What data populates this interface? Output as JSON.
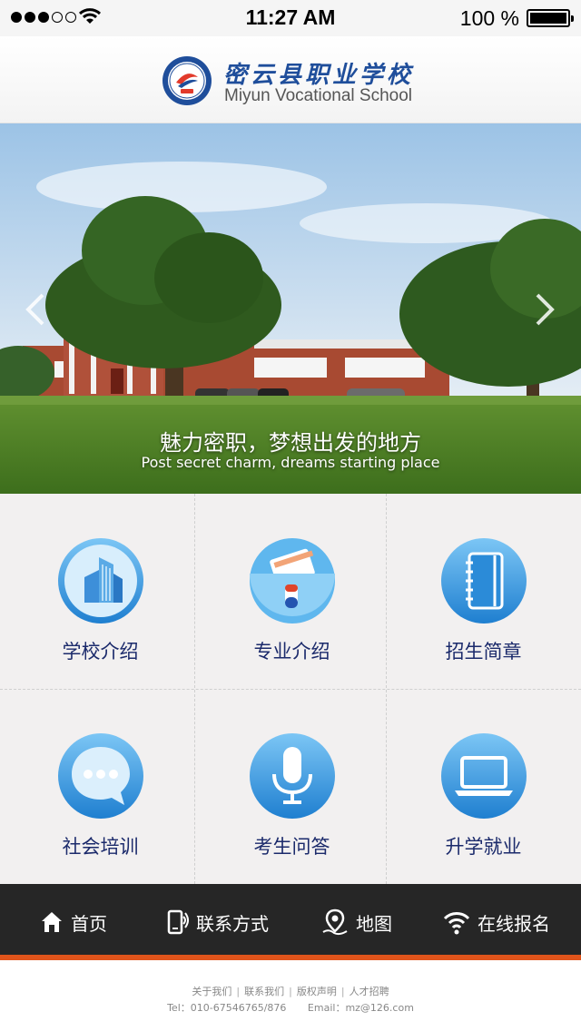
{
  "status_bar": {
    "time": "11:27 AM",
    "battery": "100 %"
  },
  "header": {
    "school_name_cn": "密云县职业学校",
    "school_name_en": "Miyun Vocational School"
  },
  "banner": {
    "caption_cn": "魅力密职，梦想出发的地方",
    "caption_en": "Post secret charm, dreams starting place"
  },
  "grid": {
    "items": [
      {
        "label": "学校介绍",
        "icon": "building-icon"
      },
      {
        "label": "专业介绍",
        "icon": "folder-icon"
      },
      {
        "label": "招生简章",
        "icon": "notebook-icon"
      },
      {
        "label": "社会培训",
        "icon": "chat-bubble-icon"
      },
      {
        "label": "考生问答",
        "icon": "microphone-icon"
      },
      {
        "label": "升学就业",
        "icon": "laptop-icon"
      }
    ]
  },
  "bottom_nav": {
    "items": [
      {
        "label": "首页",
        "icon": "home-icon"
      },
      {
        "label": "联系方式",
        "icon": "phone-contact-icon"
      },
      {
        "label": "地图",
        "icon": "map-pin-icon"
      },
      {
        "label": "在线报名",
        "icon": "wifi-icon"
      }
    ],
    "accent": "#e0541b"
  },
  "footer": {
    "links": [
      "关于我们",
      "联系我们",
      "版权声明",
      "人才招聘"
    ],
    "tel": "Tel：010-67546765/876",
    "email": "Email：mz@126.com"
  },
  "colors": {
    "brand_blue": "#1f4e9b",
    "icon_blue": "#2a8fd8",
    "label_navy": "#1b2a6b"
  }
}
